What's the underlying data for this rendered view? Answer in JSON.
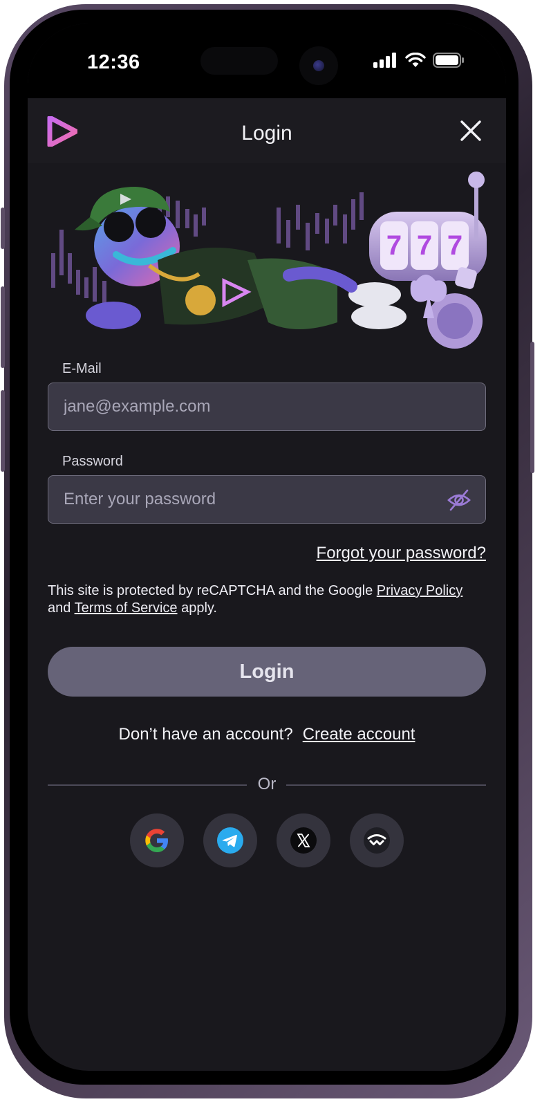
{
  "status_bar": {
    "time": "12:36"
  },
  "header": {
    "title": "Login"
  },
  "form": {
    "email": {
      "label": "E-Mail",
      "placeholder": "jane@example.com",
      "value": ""
    },
    "password": {
      "label": "Password",
      "placeholder": "Enter your password",
      "value": ""
    },
    "forgot_link": "Forgot your password?",
    "recaptcha": {
      "text_before": "This site is protected by reCAPTCHA and the Google ",
      "privacy_link": "Privacy Policy",
      "text_middle": " and ",
      "terms_link": "Terms of Service",
      "text_after": " apply."
    },
    "login_button": "Login"
  },
  "signup": {
    "prompt": "Don’t have an account?",
    "link": "Create account"
  },
  "divider_text": "Or",
  "social": [
    {
      "name": "google",
      "icon": "google-icon"
    },
    {
      "name": "telegram",
      "icon": "telegram-icon"
    },
    {
      "name": "x",
      "icon": "x-icon"
    },
    {
      "name": "walletconnect",
      "icon": "walletconnect-icon"
    }
  ],
  "colors": {
    "background": "#19181d",
    "input_bg": "#3b3946",
    "button_bg": "#666378",
    "accent": "#9b7bd6"
  }
}
